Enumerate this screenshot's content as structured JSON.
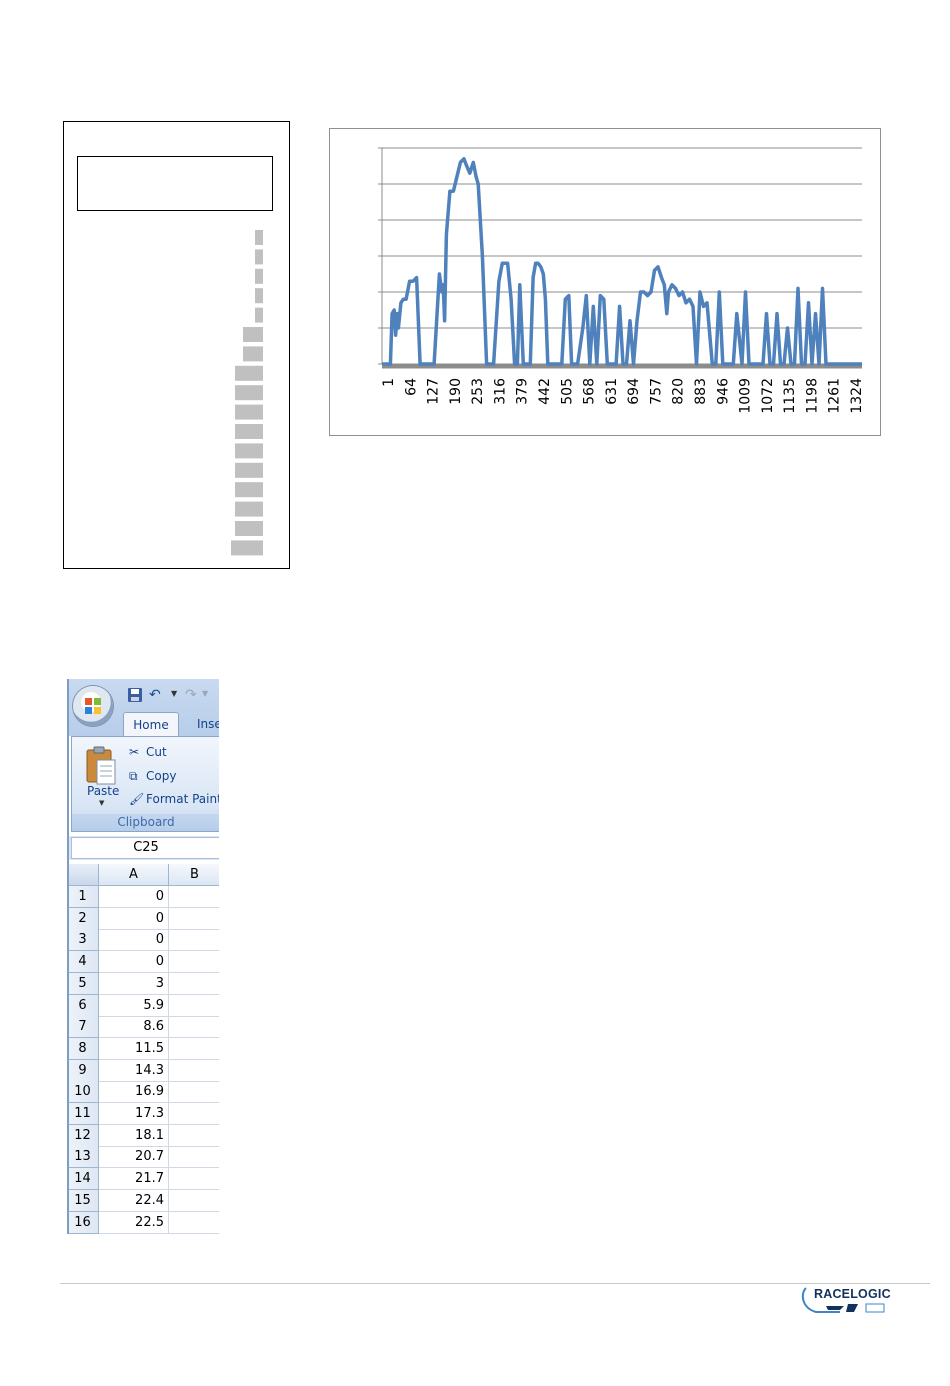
{
  "chart_data": [
    {
      "type": "bar",
      "orientation": "horizontal",
      "title": "",
      "categories": [
        "",
        "",
        "",
        "",
        "",
        "",
        "",
        "",
        "",
        "",
        "",
        "",
        "",
        "",
        "",
        "",
        ""
      ],
      "values": [
        2,
        2,
        2,
        2,
        2,
        5,
        5,
        7,
        7,
        7,
        7,
        7,
        7,
        7,
        7,
        7,
        8
      ],
      "xlabel": "",
      "ylabel": "",
      "grid": false
    },
    {
      "type": "line",
      "title": "",
      "xlabel": "",
      "ylabel": "",
      "x_tick_labels": [
        "1",
        "64",
        "127",
        "190",
        "253",
        "316",
        "379",
        "442",
        "505",
        "568",
        "631",
        "694",
        "757",
        "820",
        "883",
        "946",
        "1009",
        "1072",
        "1135",
        "1198",
        "1261",
        "1324"
      ],
      "xlim": [
        1,
        1373
      ],
      "ylim": [
        0,
        60
      ],
      "grid": true,
      "series_color": "#4f81bd",
      "series": [
        {
          "x": [
            1,
            25,
            30,
            36,
            40,
            45,
            48,
            55,
            62,
            70,
            80,
            90,
            100,
            110,
            115,
            120,
            125,
            150,
            165,
            172,
            176,
            180,
            185,
            195,
            205,
            215,
            225,
            235,
            243,
            252,
            262,
            270,
            276,
            282,
            288,
            300,
            310,
            320,
            335,
            345,
            360,
            370,
            380,
            388,
            395,
            405,
            415,
            425,
            433,
            440,
            447,
            455,
            462,
            468,
            475,
            487,
            500,
            515,
            525,
            535,
            543,
            550,
            560,
            575,
            585,
            595,
            605,
            615,
            625,
            635,
            645,
            655,
            670,
            680,
            690,
            700,
            710,
            720,
            730,
            740,
            750,
            760,
            770,
            780,
            790,
            800,
            808,
            815,
            820,
            830,
            840,
            850,
            860,
            870,
            880,
            890,
            900,
            910,
            920,
            930,
            945,
            955,
            965,
            975,
            985,
            995,
            1005,
            1015,
            1030,
            1040,
            1050,
            1060,
            1070,
            1080,
            1090,
            1100,
            1110,
            1120,
            1130,
            1140,
            1150,
            1160,
            1170,
            1180,
            1190,
            1200,
            1210,
            1220,
            1230,
            1240,
            1250,
            1260,
            1270,
            1280,
            1290,
            1300,
            1310,
            1320,
            1330,
            1340,
            1350,
            1360,
            1373
          ],
          "y": [
            0,
            0,
            14,
            15,
            8,
            14,
            10,
            17,
            18,
            18,
            23,
            23,
            24,
            0,
            0,
            0,
            0,
            0,
            25,
            20,
            22,
            12,
            36,
            48,
            48,
            52,
            56,
            57,
            55,
            53,
            56,
            52,
            50,
            40,
            30,
            0,
            0,
            0,
            23,
            28,
            28,
            18,
            0,
            0,
            22,
            0,
            0,
            0,
            24,
            28,
            28,
            27,
            25,
            18,
            0,
            0,
            0,
            0,
            18,
            19,
            0,
            0,
            0,
            10,
            19,
            0,
            16,
            0,
            19,
            18,
            0,
            0,
            0,
            16,
            0,
            0,
            12,
            0,
            12,
            20,
            20,
            19,
            20,
            26,
            27,
            24,
            22,
            14,
            20,
            22,
            21,
            19,
            20,
            17,
            18,
            16,
            0,
            20,
            16,
            17,
            0,
            0,
            20,
            0,
            0,
            0,
            0,
            14,
            0,
            20,
            0,
            0,
            0,
            0,
            0,
            14,
            0,
            0,
            14,
            0,
            0,
            10,
            0,
            0,
            21,
            0,
            0,
            17,
            0,
            14,
            0,
            21,
            0,
            0,
            0,
            0,
            0,
            0,
            0,
            0,
            0,
            0,
            0
          ]
        }
      ]
    }
  ],
  "excel": {
    "tabs": {
      "home": "Home",
      "insert": "Inse"
    },
    "clipboard": {
      "paste": "Paste",
      "cut": "Cut",
      "copy": "Copy",
      "format_painter": "Format Paint",
      "group_label": "Clipboard"
    },
    "name_box": "C25",
    "columns": [
      "A",
      "B"
    ],
    "rows": [
      {
        "num": "1",
        "a": "0"
      },
      {
        "num": "2",
        "a": "0"
      },
      {
        "num": "3",
        "a": "0"
      },
      {
        "num": "4",
        "a": "0"
      },
      {
        "num": "5",
        "a": "3"
      },
      {
        "num": "6",
        "a": "5.9"
      },
      {
        "num": "7",
        "a": "8.6"
      },
      {
        "num": "8",
        "a": "11.5"
      },
      {
        "num": "9",
        "a": "14.3"
      },
      {
        "num": "10",
        "a": "16.9"
      },
      {
        "num": "11",
        "a": "17.3"
      },
      {
        "num": "12",
        "a": "18.1"
      },
      {
        "num": "13",
        "a": "20.7"
      },
      {
        "num": "14",
        "a": "21.7"
      },
      {
        "num": "15",
        "a": "22.4"
      },
      {
        "num": "16",
        "a": "22.5"
      }
    ]
  },
  "footer": {
    "logo_text": "RACELOGIC"
  },
  "icons": {
    "office": "office-button-icon",
    "save": "save-icon",
    "undo": "undo-icon",
    "redo": "redo-icon",
    "paste": "paste-icon",
    "cut": "scissors-icon",
    "copy": "copy-icon",
    "format_painter": "paintbrush-icon"
  }
}
